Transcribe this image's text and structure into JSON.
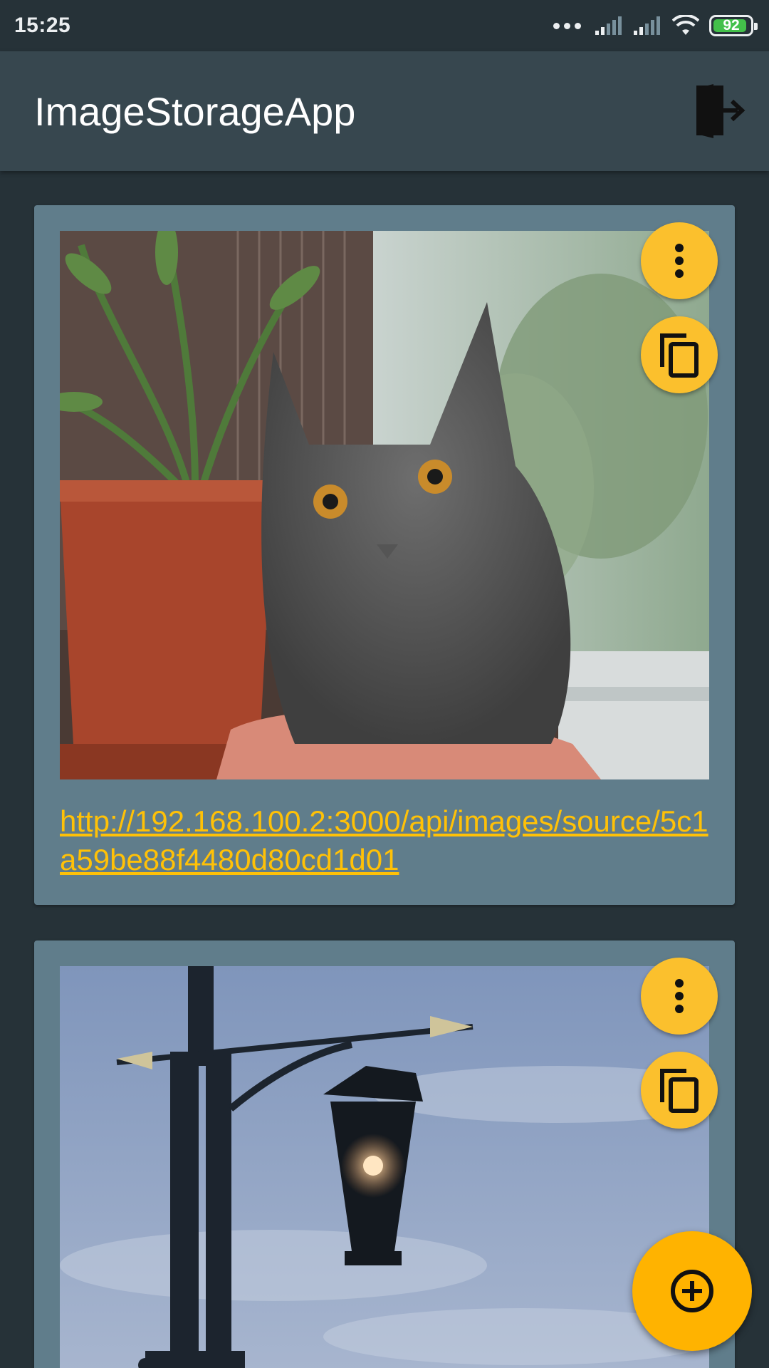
{
  "status_bar": {
    "time": "15:25",
    "battery_percent": 92,
    "battery_label": "92",
    "icons": [
      "more-dots-icon",
      "signal-icon",
      "signal-icon",
      "wifi-icon",
      "battery-icon"
    ]
  },
  "app_bar": {
    "title": "ImageStorageApp",
    "action_icon": "logout-icon"
  },
  "images": [
    {
      "image": "cat-photo",
      "link": "http://192.168.100.2:3000/api/images/source/5c1a59be88f4480d80cd1d01",
      "actions": [
        "more-vert-icon",
        "copy-icon"
      ]
    },
    {
      "image": "street-lamp-photo",
      "actions": [
        "more-vert-icon",
        "copy-icon"
      ]
    }
  ],
  "fab": {
    "icon": "add-circle-icon"
  },
  "colors": {
    "background": "#263238",
    "app_bar": "#37474f",
    "card": "#607d8b",
    "accent": "#ffc107",
    "fab": "#ffb300"
  }
}
